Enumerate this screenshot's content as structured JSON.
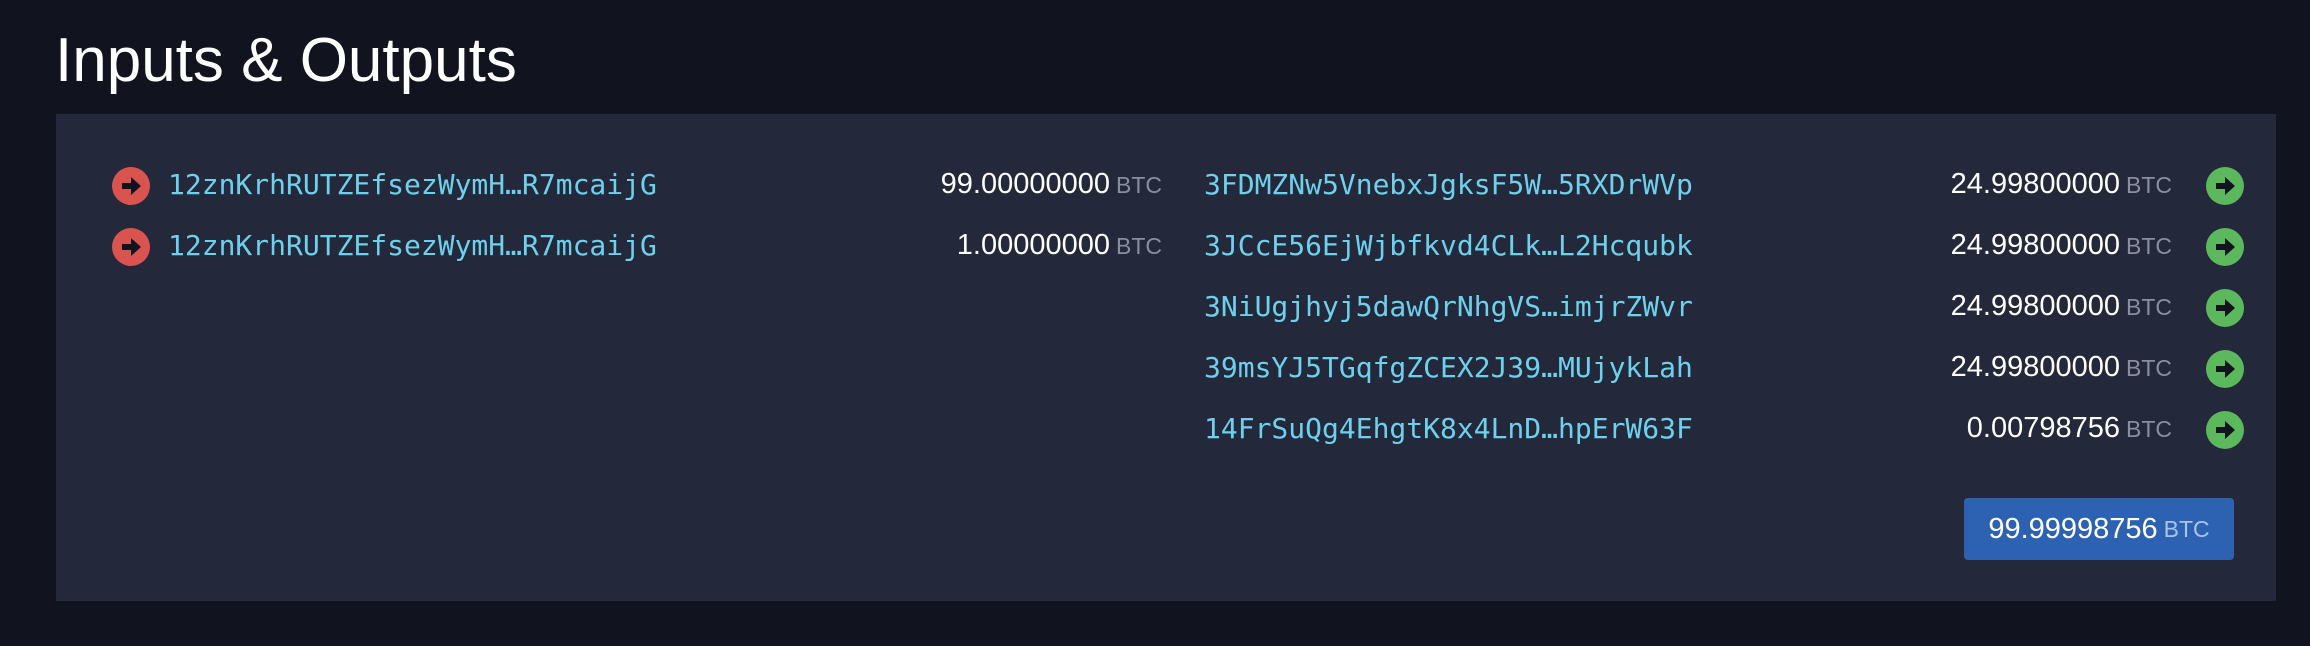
{
  "page": {
    "title": "Inputs & Outputs"
  },
  "unit": "BTC",
  "inputs": [
    {
      "address": "12znKrhRUTZEfsezWymH…R7mcaijG",
      "amount": "99.00000000"
    },
    {
      "address": "12znKrhRUTZEfsezWymH…R7mcaijG",
      "amount": "1.00000000"
    }
  ],
  "outputs": [
    {
      "address": "3FDMZNw5VnebxJgksF5W…5RXDrWVp",
      "amount": "24.99800000"
    },
    {
      "address": "3JCcE56EjWjbfkvd4CLk…L2Hcqubk",
      "amount": "24.99800000"
    },
    {
      "address": "3NiUgjhyj5dawQrNhgVS…imjrZWvr",
      "amount": "24.99800000"
    },
    {
      "address": "39msYJ5TGqfgZCEX2J39…MUjykLah",
      "amount": "24.99800000"
    },
    {
      "address": "14FrSuQg4EhgtK8x4LnD…hpErW63F",
      "amount": "0.00798756"
    }
  ],
  "total": {
    "amount": "99.99998756"
  },
  "colors": {
    "background": "#11141f",
    "panel": "#24283b",
    "address": "#6fd0ec",
    "input_icon": "#d9534f",
    "output_icon": "#5cb85c",
    "total_badge": "#2d62b3"
  },
  "icons": {
    "input": "arrow-right-circle-icon",
    "output": "arrow-right-circle-icon"
  }
}
